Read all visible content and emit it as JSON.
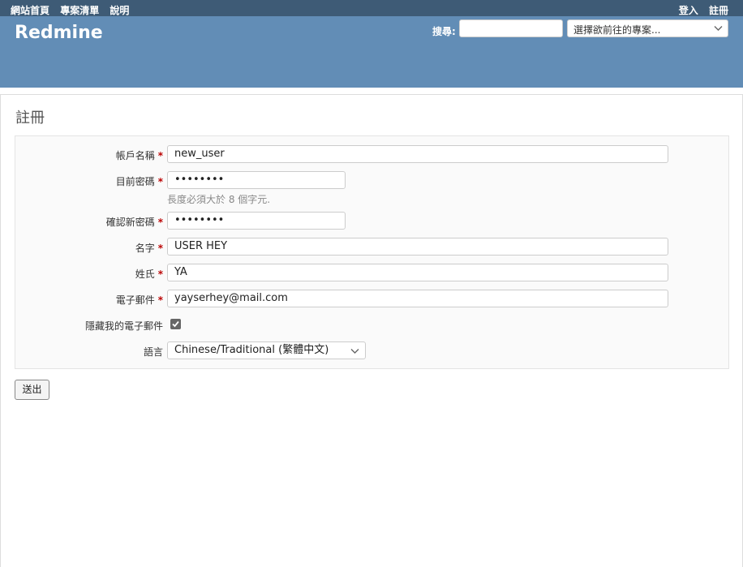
{
  "top_menu": {
    "left_items": [
      "網站首頁",
      "專案清單",
      "說明"
    ],
    "right_items": [
      "登入",
      "註冊"
    ]
  },
  "header": {
    "logo": "Redmine",
    "search_label": "搜尋:",
    "search_value": "",
    "project_jump": "選擇欲前往的專案..."
  },
  "page": {
    "title": "註冊"
  },
  "form": {
    "login": {
      "label": "帳戶名稱",
      "value": "new_user"
    },
    "password": {
      "label": "目前密碼",
      "value": "••••••••",
      "hint": "長度必須大於 8 個字元."
    },
    "password_confirmation": {
      "label": "確認新密碼",
      "value": "••••••••"
    },
    "firstname": {
      "label": "名字",
      "value": "USER HEY"
    },
    "lastname": {
      "label": "姓氏",
      "value": "YA"
    },
    "mail": {
      "label": "電子郵件",
      "value": "yayserhey@mail.com"
    },
    "hide_mail": {
      "label": "隱藏我的電子郵件",
      "checked": true
    },
    "language": {
      "label": "語言",
      "value": "Chinese/Traditional (繁體中文)"
    },
    "required_marker": "*",
    "submit_label": "送出"
  },
  "colors": {
    "top_menu_bg": "#3e5b76",
    "header_bg": "#628db6",
    "required": "#bb0000"
  }
}
